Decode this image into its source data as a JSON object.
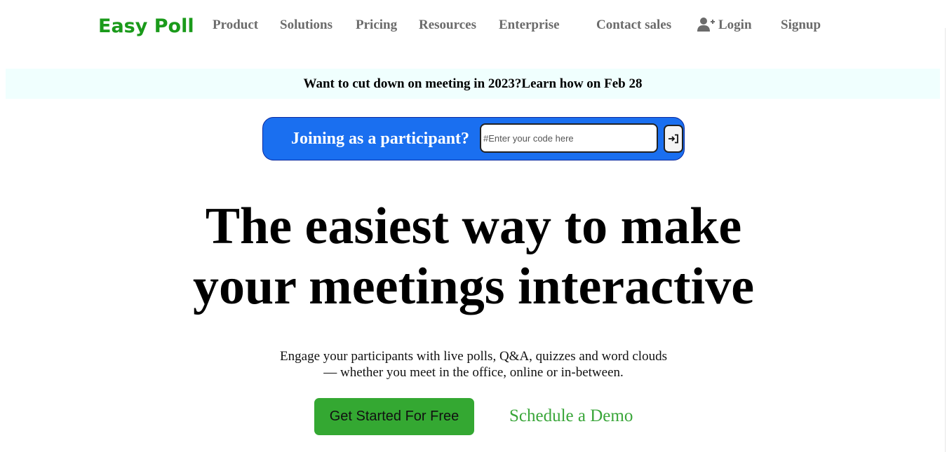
{
  "brand": {
    "name": "Easy Poll",
    "color": "#1a9a1a"
  },
  "nav": {
    "product": "Product",
    "solutions": "Solutions",
    "pricing": "Pricing",
    "resources": "Resources",
    "enterprise": "Enterprise",
    "contact_sales": "Contact sales",
    "login": "Login",
    "login_icon": "user-plus-icon",
    "signup": "Signup",
    "text_color": "#6b6b6b"
  },
  "banner": {
    "text": "Want to cut down on meeting in 2023?Learn how on Feb 28",
    "background": "#f0fffe"
  },
  "join": {
    "label": "Joining as a participant?",
    "input_placeholder": "#Enter your code here",
    "input_value": "",
    "submit_icon": "sign-in-arrow-icon",
    "background": "#1a6ff0"
  },
  "hero": {
    "title_line1": "The easiest way to make",
    "title_line2": "your meetings interactive",
    "subtitle_line1": "Engage your participants with live polls, Q&A, quizzes and word clouds",
    "subtitle_line2": "— whether you meet in the office, online or in-between."
  },
  "cta": {
    "primary": "Get Started For Free",
    "primary_color": "#34a832",
    "secondary": "Schedule a Demo",
    "secondary_color": "#3aa63a"
  }
}
